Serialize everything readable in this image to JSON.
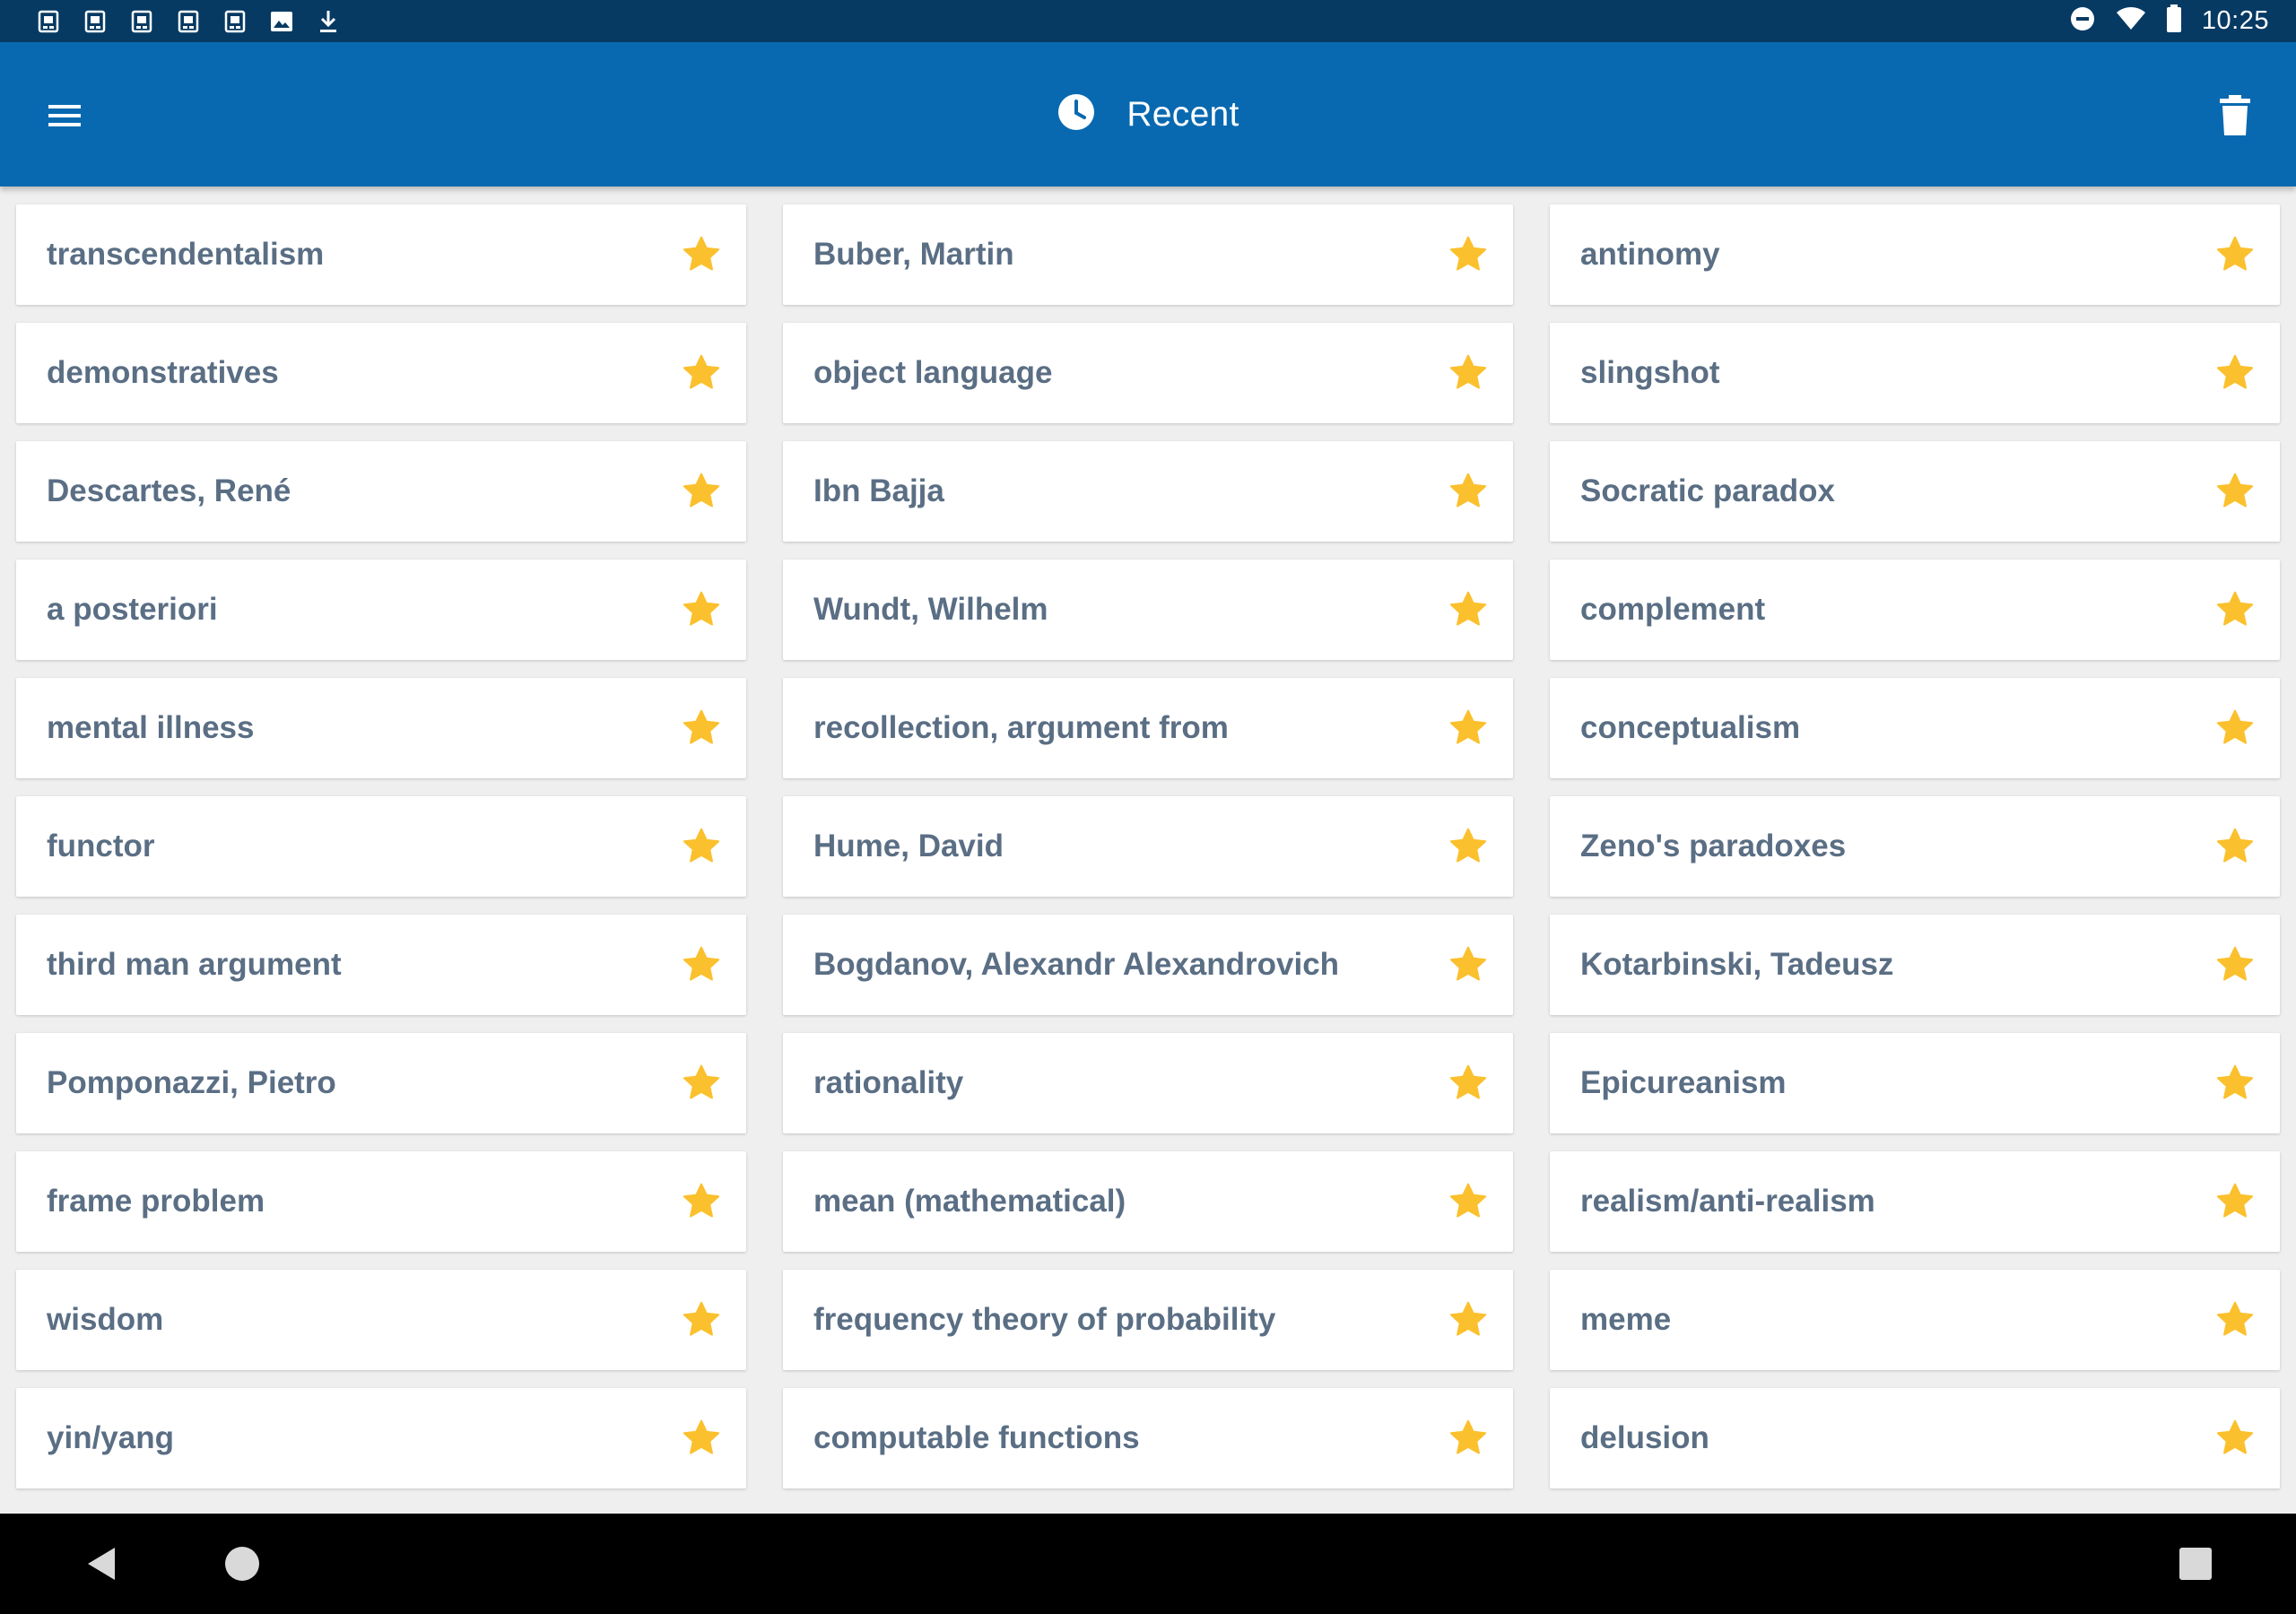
{
  "status_bar": {
    "time": "10:25",
    "left_icons": [
      "notification-app-icon",
      "notification-app-icon",
      "notification-app-icon",
      "notification-app-icon",
      "notification-app-icon",
      "image-icon",
      "download-icon"
    ],
    "right_icons": [
      "do-not-disturb-icon",
      "wifi-icon",
      "battery-icon"
    ]
  },
  "app_bar": {
    "title": "Recent",
    "title_icon": "clock-icon",
    "menu_icon": "hamburger-menu-icon",
    "action_icon": "trash-icon",
    "color": "#0869b0"
  },
  "accent": {
    "star_color": "#fbc02d",
    "label_color": "#5a6e84"
  },
  "items": [
    "transcendentalism",
    "Buber, Martin",
    "antinomy",
    "demonstratives",
    "object language",
    "slingshot",
    "Descartes, René",
    "Ibn Bajja",
    "Socratic paradox",
    "a posteriori",
    "Wundt, Wilhelm",
    "complement",
    "mental illness",
    "recollection, argument from",
    "conceptualism",
    "functor",
    "Hume, David",
    "Zeno's paradoxes",
    "third man argument",
    "Bogdanov, Alexandr Alexandrovich",
    "Kotarbinski, Tadeusz",
    "Pomponazzi, Pietro",
    "rationality",
    "Epicureanism",
    "frame problem",
    "mean (mathematical)",
    "realism/anti-realism",
    "wisdom",
    "frequency theory of probability",
    "meme",
    "yin/yang",
    "computable functions",
    "delusion"
  ],
  "nav_bar": {
    "back_icon": "back-triangle-icon",
    "home_icon": "home-circle-icon",
    "recents_icon": "recents-square-icon"
  }
}
